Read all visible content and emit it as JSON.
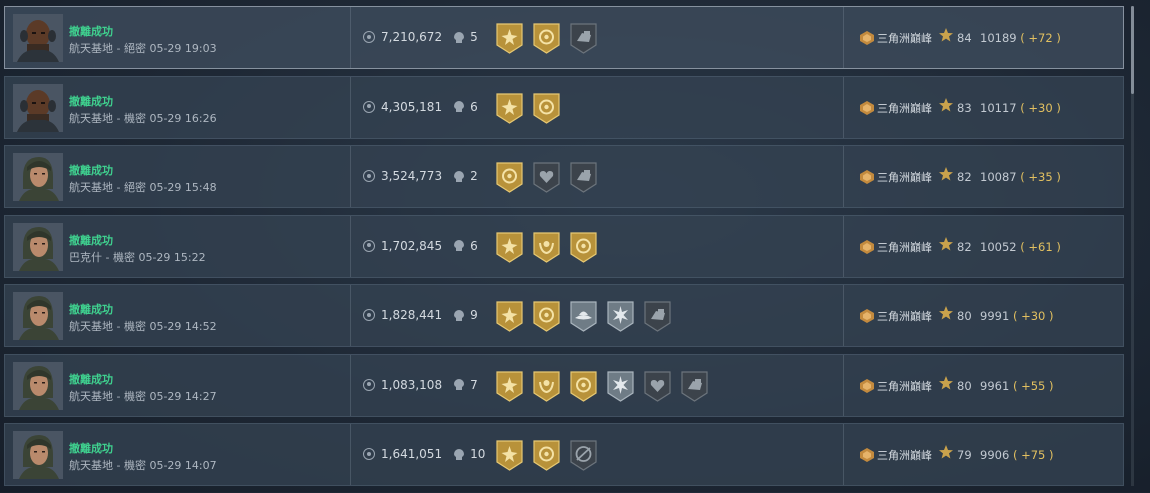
{
  "rows": [
    {
      "status": "撤離成功",
      "location": "航天基地",
      "difficulty": "絕密",
      "datetime": "05-29 19:03",
      "coins": "7,210,672",
      "kills": "5",
      "badges": [
        "gold-star",
        "gold-ring",
        "gray-hand"
      ],
      "mode": "三角洲巔峰",
      "level": "84",
      "score": "10189",
      "delta": "( +72 )",
      "avatar": "male"
    },
    {
      "status": "撤離成功",
      "location": "航天基地",
      "difficulty": "機密",
      "datetime": "05-29 16:26",
      "coins": "4,305,181",
      "kills": "6",
      "badges": [
        "gold-star",
        "gold-ring"
      ],
      "mode": "三角洲巔峰",
      "level": "83",
      "score": "10117",
      "delta": "( +30 )",
      "avatar": "male"
    },
    {
      "status": "撤離成功",
      "location": "航天基地",
      "difficulty": "絕密",
      "datetime": "05-29 15:48",
      "coins": "3,524,773",
      "kills": "2",
      "badges": [
        "gold-ring",
        "gray-heart",
        "gray-hand"
      ],
      "mode": "三角洲巔峰",
      "level": "82",
      "score": "10087",
      "delta": "( +35 )",
      "avatar": "female"
    },
    {
      "status": "撤離成功",
      "location": "巴克什",
      "difficulty": "機密",
      "datetime": "05-29 15:22",
      "coins": "1,702,845",
      "kills": "6",
      "badges": [
        "gold-star",
        "gold-wreath",
        "gold-ring"
      ],
      "mode": "三角洲巔峰",
      "level": "82",
      "score": "10052",
      "delta": "( +61 )",
      "avatar": "female"
    },
    {
      "status": "撤離成功",
      "location": "航天基地",
      "difficulty": "機密",
      "datetime": "05-29 14:52",
      "coins": "1,828,441",
      "kills": "9",
      "badges": [
        "gold-star",
        "gold-ring",
        "silver-hat",
        "silver-burst",
        "gray-hand"
      ],
      "mode": "三角洲巔峰",
      "level": "80",
      "score": "9991",
      "delta": "( +30 )",
      "avatar": "female"
    },
    {
      "status": "撤離成功",
      "location": "航天基地",
      "difficulty": "機密",
      "datetime": "05-29 14:27",
      "coins": "1,083,108",
      "kills": "7",
      "badges": [
        "gold-star",
        "gold-wreath",
        "gold-ring",
        "silver-burst",
        "gray-heart",
        "gray-hand"
      ],
      "mode": "三角洲巔峰",
      "level": "80",
      "score": "9961",
      "delta": "( +55 )",
      "avatar": "female"
    },
    {
      "status": "撤離成功",
      "location": "航天基地",
      "difficulty": "機密",
      "datetime": "05-29 14:07",
      "coins": "1,641,051",
      "kills": "10",
      "badges": [
        "gold-star",
        "gold-ring",
        "gray-target"
      ],
      "mode": "三角洲巔峰",
      "level": "79",
      "score": "9906",
      "delta": "( +75 )",
      "avatar": "female"
    }
  ],
  "colors": {
    "success": "#3fd18f",
    "delta": "#e2c060",
    "gold": "#b8923a",
    "silver": "#6f7c86",
    "gray": "#3c434b"
  }
}
